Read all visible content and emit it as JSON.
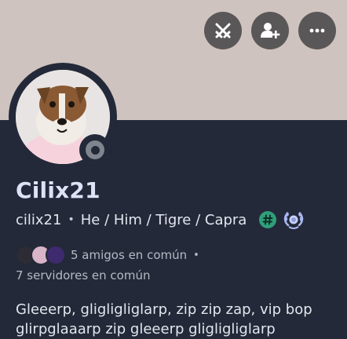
{
  "profile": {
    "display_name": "Cilix21",
    "username": "cilix21",
    "pronouns": "He / Him / Tigre / Capra",
    "separator": "•",
    "tag_badge_glyph": "#",
    "status": "offline",
    "mutual_friends": "5 amigos en común",
    "mutual_servers": "7 servidores en común",
    "bio": "Gleeerp, gligligliglarp, zip zip zap, vip bop glirpglaaarp zip gleeerp gligligliglarp"
  },
  "actions": [
    {
      "icon": "swords-icon"
    },
    {
      "icon": "add-friend-icon"
    },
    {
      "icon": "more-icon"
    }
  ],
  "colors": {
    "banner": "#cfc3bf",
    "background": "#232938",
    "action_button": "#5a5758",
    "tag_badge": "#2f9f7a",
    "wreath_badge": "#a8b6f0",
    "status_offline": "#80848e"
  }
}
